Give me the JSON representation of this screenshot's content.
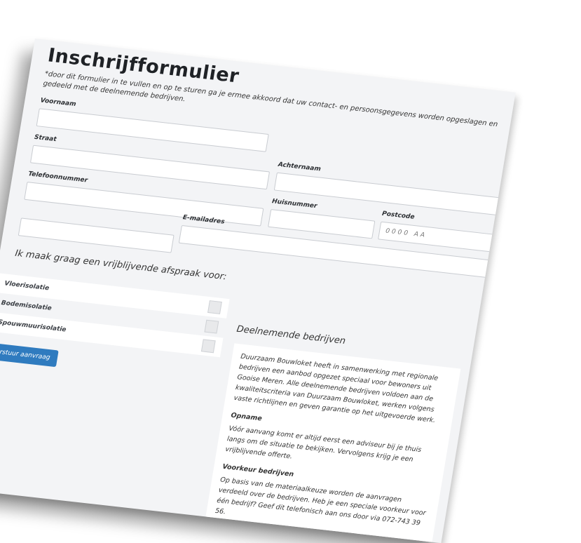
{
  "form": {
    "title": "Inschrijfformulier",
    "consent_text": "*door dit formulier in te vullen en op te sturen ga je ermee akkoord dat uw contact- en persoonsgegevens worden opgeslagen en gedeeld met de deelnemende bedrijven.",
    "fields": {
      "voornaam": {
        "label": "Voornaam",
        "value": ""
      },
      "achternaam": {
        "label": "Achternaam",
        "value": ""
      },
      "straat": {
        "label": "Straat",
        "value": ""
      },
      "huisnummer": {
        "label": "Huisnummer",
        "value": ""
      },
      "postcode": {
        "label": "Postcode",
        "placeholder": "0000 AA",
        "value": ""
      },
      "telefoonnummer": {
        "label": "Telefoonnummer",
        "value": ""
      },
      "emailadres": {
        "label": "E-mailadres",
        "value": ""
      }
    },
    "appointment_heading": "Ik maak graag een vrijblijvende afspraak voor:",
    "options": [
      {
        "label": "Vloerisolatie",
        "checked": false
      },
      {
        "label": "Bodemisolatie",
        "checked": false
      },
      {
        "label": "Spouwmuurisolatie",
        "checked": false
      }
    ],
    "submit_label": "Verstuur aanvraag"
  },
  "companies": {
    "heading": "Deelnemende bedrijven",
    "intro": "Duurzaam Bouwloket heeft in samenwerking met regionale bedrijven een aanbod opgezet speciaal voor bewoners uit Gooise Meren. Alle deelnemende bedrijven voldoen aan de kwaliteitscriteria van Duurzaam Bouwloket, werken volgens vaste richtlijnen en geven garantie op het uitgevoerde werk.",
    "sections": [
      {
        "title": "Opname",
        "text": "Vóór aanvang komt er altijd eerst een adviseur bij je thuis langs om de situatie te bekijken. Vervolgens krijg je een vrijblijvende offerte."
      },
      {
        "title": "Voorkeur bedrijven",
        "text": "Op basis van de materiaalkeuze worden de aanvragen verdeeld over de bedrijven. Heb je een speciale voorkeur voor één bedrijf? Geef dit telefonisch aan ons door via 072-743 39 56."
      }
    ]
  }
}
